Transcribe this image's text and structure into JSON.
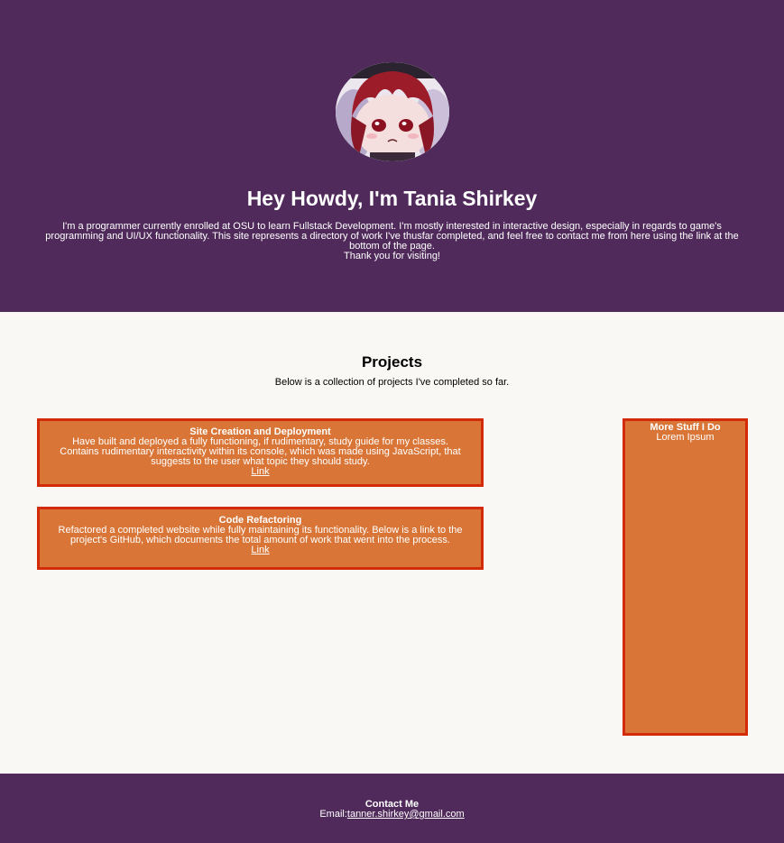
{
  "hero": {
    "avatar_alt": "profile-avatar",
    "title": "Hey Howdy, I'm Tania Shirkey",
    "intro": "I'm a programmer currently enrolled at OSU to learn Fullstack Development. I'm mostly interested in interactive design, especially in regards to game's programming and UI/UX functionality. This site represents a directory of work I've thusfar completed, and feel free to contact me from here using the link at the bottom of the page.",
    "thanks": "Thank you for visiting!"
  },
  "projects": {
    "title": "Projects",
    "subtitle": "Below is a collection of projects I've completed so far.",
    "cards": [
      {
        "title": "Site Creation and Deployment",
        "description": "Have built and deployed a fully functioning, if rudimentary, study guide for my classes. Contains rudimentary interactivity within its console, which was made using JavaScript, that suggests to the user what topic they should study.",
        "link_label": "Link"
      },
      {
        "title": "Code Refactoring",
        "description": "Refactored a completed website while fully maintaining its functionality. Below is a link to the project's GitHub, which documents the total amount of work that went into the process.",
        "link_label": "Link"
      }
    ],
    "side": {
      "title": "More Stuff I Do",
      "text": "Lorem Ipsum"
    }
  },
  "footer": {
    "title": "Contact Me",
    "email_label": "Email:",
    "email": "tanner.shirkey@gmail.com"
  },
  "colors": {
    "header_bg": "#4f2a5a",
    "page_bg": "#f9f8f4",
    "card_bg": "#d97637",
    "card_border": "#d32a08"
  }
}
